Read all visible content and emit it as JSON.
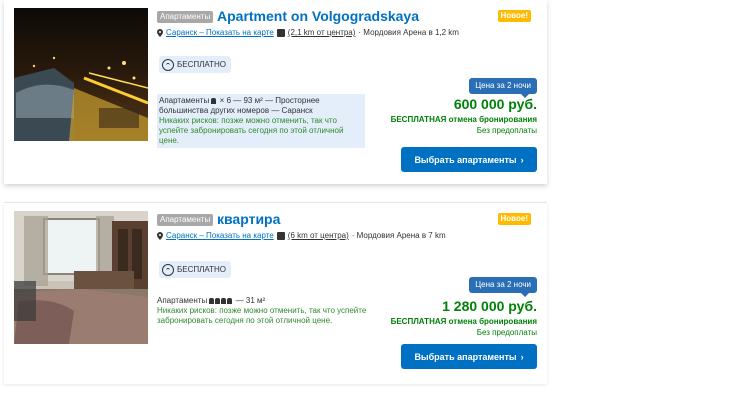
{
  "listings": [
    {
      "type_badge": "Апартаменты",
      "title": "Apartment on Volgogradskaya",
      "new_badge": "Новое!",
      "location_link": "Саранск – Показать на карте",
      "distance": "(2,1 km от центра)",
      "landmark": "· Мордовия Арена в 1,2 km",
      "wifi": "БЕСПЛАТНО",
      "room_prefix": "Апартаменты",
      "room_detail": "× 6 — 93 м² — Просторнее большинства других номеров — Саранск",
      "risk_text": "Никаких рисков: позже можно отменить, так что успейте забронировать сегодня по этой отличной цене.",
      "price_tag": "Цена за 2 ночи",
      "price": "600 000 руб.",
      "cancel": "БЕСПЛАТНАЯ отмена бронирования",
      "prepay": "Без предоплаты",
      "button": "Выбрать апартаменты",
      "button_chevron": "›"
    },
    {
      "type_badge": "Апартаменты",
      "title": "квартира",
      "new_badge": "Новое!",
      "location_link": "Саранск – Показать на карте",
      "distance": "(6 km от центра)",
      "landmark": "· Мордовия Арена в 7 km",
      "wifi": "БЕСПЛАТНО",
      "room_prefix": "Апартаменты",
      "room_detail": "— 31 м²",
      "risk_text": "Никаких рисков: позже можно отменить, так что успейте забронировать сегодня по этой отличной цене.",
      "price_tag": "Цена за 2 ночи",
      "price": "1 280 000 руб.",
      "cancel": "БЕСПЛАТНАЯ отмена бронирования",
      "prepay": "Без предоплаты",
      "button": "Выбрать апартаменты",
      "button_chevron": "›"
    }
  ],
  "colors": {
    "brand_blue": "#0071c2",
    "green": "#008009",
    "new_badge": "#febb02"
  }
}
